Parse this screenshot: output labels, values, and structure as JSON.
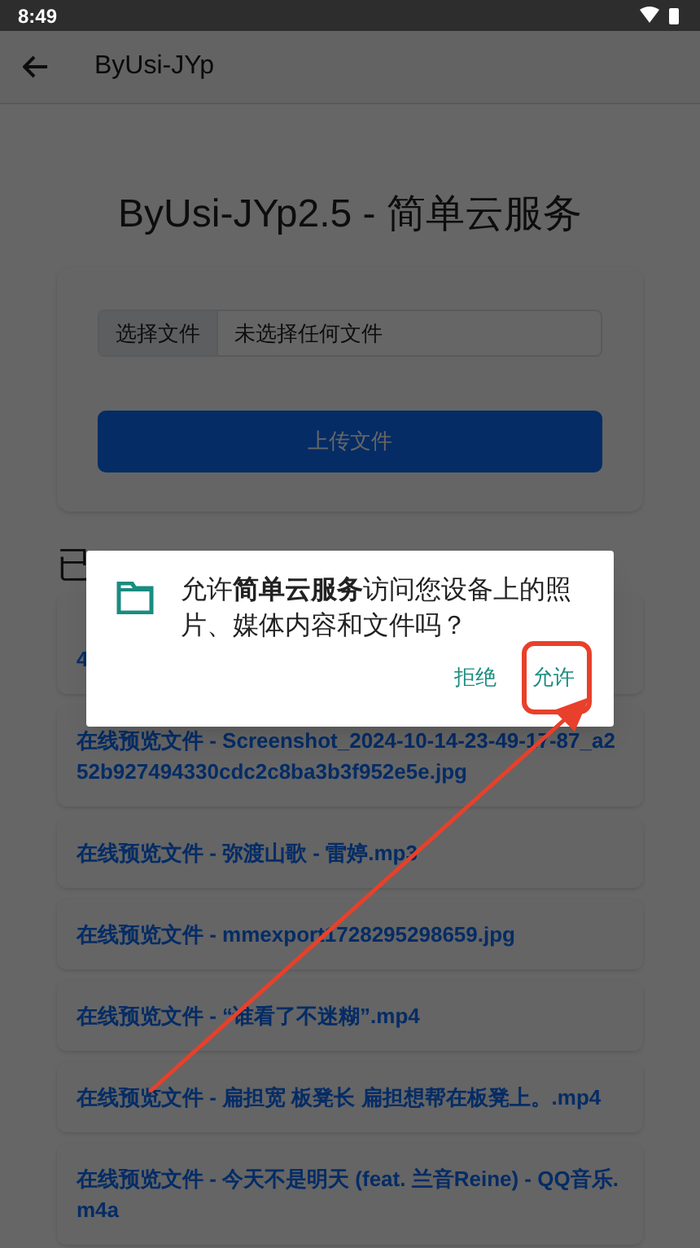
{
  "status_bar": {
    "time": "8:49"
  },
  "app_bar": {
    "title": "ByUsi-JYp"
  },
  "page": {
    "heading": "ByUsi-JYp2.5 - 简单云服务",
    "file_input": {
      "button": "选择文件",
      "value": "未选择任何文件"
    },
    "upload_button": "上传文件",
    "section_heading": "已",
    "files": [
      {
        "lines": [
          "4"
        ]
      },
      {
        "lines": [
          "在线预览文件 - Screenshot_2024-10-14-23-49-17-87_a252b927494330cdc2c8ba3b3f952e5e.jpg"
        ]
      },
      {
        "lines": [
          "在线预览文件 - 弥渡山歌 - 雷婷.mp3"
        ]
      },
      {
        "lines": [
          "在线预览文件 - mmexport1728295298659.jpg"
        ]
      },
      {
        "lines": [
          "在线预览文件 - “谁看了不迷糊”.mp4"
        ]
      },
      {
        "lines": [
          "在线预览文件 - 扁担宽 板凳长 扁担想帮在板凳上。.mp4"
        ]
      },
      {
        "lines": [
          "在线预览文件 - 今天不是明天 (feat. 兰音Reine) - QQ音乐.m4a"
        ]
      }
    ]
  },
  "dialog": {
    "message": "允许**简单云服务**访问您设备上的照片、媒体内容和文件吗？",
    "buttons": [
      "拒绝",
      "允许"
    ]
  }
}
